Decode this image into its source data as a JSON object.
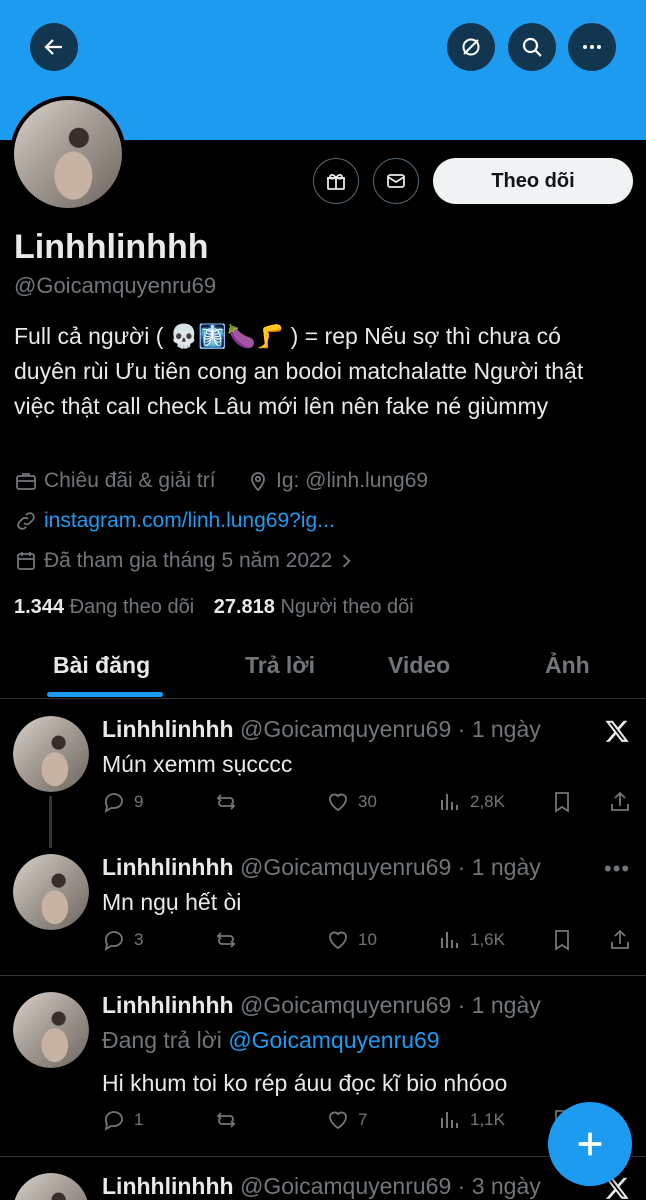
{
  "header": {
    "back_icon": "arrow-left-icon",
    "hide_icon": "slash-circle-icon",
    "search_icon": "search-icon",
    "more_icon": "more-icon",
    "banner_color": "#1d9bf0"
  },
  "profile": {
    "name": "Linhhlinhhh",
    "handle": "@Goicamquyenru69",
    "follow_label": "Theo dõi",
    "bio": "Full cả người ( 💀🩻🍆🦵 ) = rep Nếu sợ thì chưa có duyên rùi Ưu tiên cong an bodoi matchalatte Người thật việc thật call check Lâu mới lên nên fake né giùmmy",
    "category": "Chiêu đãi & giải trí",
    "location": "Ig: @linh.lung69",
    "website": "instagram.com/linh.lung69?ig...",
    "joined": "Đã tham gia tháng 5 năm 2022",
    "following_count": "1.344",
    "following_label": "Đang theo dõi",
    "followers_count": "27.818",
    "followers_label": "Người theo dõi"
  },
  "tabs": [
    "Bài đăng",
    "Trả lời",
    "Video",
    "Ảnh"
  ],
  "tweets": [
    {
      "name": "Linhhlinhhh",
      "meta": "@Goicamquyenru69 · 1 ngày",
      "text": "Mún xemm sụcccc",
      "reply": "9",
      "retweet": "",
      "like": "30",
      "views": "2,8K"
    },
    {
      "name": "Linhhlinhhh",
      "meta": "@Goicamquyenru69 · 1 ngày",
      "text": "Mn ngụ hết òi",
      "reply": "3",
      "retweet": "",
      "like": "10",
      "views": "1,6K"
    },
    {
      "name": "Linhhlinhhh",
      "meta": "@Goicamquyenru69 · 1 ngày",
      "replying_prefix": "Đang trả lời",
      "replying_to": "@Goicamquyenru69",
      "text": "Hi khum toi ko rép áuu đọc kĩ bio nhóoo",
      "reply": "1",
      "retweet": "",
      "like": "7",
      "views": "1,1K"
    },
    {
      "name": "Linhhlinhhh",
      "meta": "@Goicamquyenru69 · 3 ngày"
    }
  ],
  "colors": {
    "accent": "#1d9bf0",
    "muted": "#71767b",
    "text": "#e7e9ea"
  }
}
